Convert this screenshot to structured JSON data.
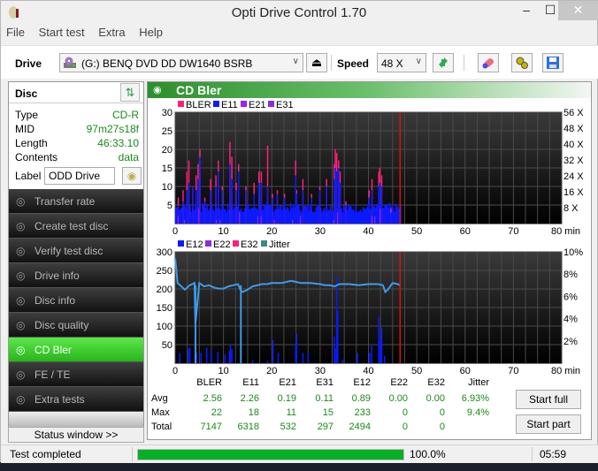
{
  "window": {
    "title": "Opti Drive Control 1.70",
    "minimize": "–",
    "maximize": "☐",
    "close": "✕"
  },
  "menu": [
    "File",
    "Start test",
    "Extra",
    "Help"
  ],
  "toolbar": {
    "drive_label": "Drive",
    "drive_value": "(G:)   BENQ DVD DD DW1640 BSRB",
    "speed_label": "Speed",
    "speed_value": "48 X",
    "icons": [
      "eject-icon",
      "refresh-icon",
      "eraser-icon",
      "settings-icon",
      "save-icon"
    ]
  },
  "disc": {
    "header": "Disc",
    "rows": [
      {
        "key": "Type",
        "value": "CD-R"
      },
      {
        "key": "MID",
        "value": "97m27s18f"
      },
      {
        "key": "Length",
        "value": "46:33.10"
      },
      {
        "key": "Contents",
        "value": "data"
      }
    ],
    "label_key": "Label",
    "label_value": "ODD Drive"
  },
  "nav": [
    {
      "label": "Transfer rate",
      "active": false
    },
    {
      "label": "Create test disc",
      "active": false
    },
    {
      "label": "Verify test disc",
      "active": false
    },
    {
      "label": "Drive info",
      "active": false
    },
    {
      "label": "Disc info",
      "active": false
    },
    {
      "label": "Disc quality",
      "active": false
    },
    {
      "label": "CD Bler",
      "active": true
    },
    {
      "label": "FE / TE",
      "active": false
    },
    {
      "label": "Extra tests",
      "active": false
    }
  ],
  "status_window_button": "Status window >>",
  "panel_title": "CD Bler",
  "colors": {
    "bler": "#ff1f7a",
    "e11": "#0b1aff",
    "e21": "#a020f0",
    "e31": "#8a2be2",
    "e12": "#0b1aff",
    "e22": "#8a2be2",
    "e32": "#ff1f7a",
    "jitter": "#3d9bea",
    "jitter_legend": "#3c8a7a",
    "marker": "#e01010",
    "accent_green": "#27b51a"
  },
  "chart_data": [
    {
      "type": "bar",
      "title": "BLER / E11 / E21 / E31",
      "legend": [
        "BLER",
        "E11",
        "E21",
        "E31"
      ],
      "legend_position": "top-left",
      "xlabel": "min",
      "x_ticks": [
        "0",
        "10",
        "20",
        "30",
        "40",
        "50",
        "60",
        "70",
        "80 min"
      ],
      "xlim": [
        0,
        80
      ],
      "ylim": [
        0,
        30
      ],
      "y_ticks": [
        "5",
        "10",
        "15",
        "20",
        "25",
        "30"
      ],
      "y2_ticks": [
        "8 X",
        "16 X",
        "24 X",
        "32 X",
        "40 X",
        "48 X",
        "56 X"
      ],
      "y2lim": [
        0,
        56
      ],
      "marker_x": 46.55,
      "grid": true,
      "series": [
        {
          "name": "BLER",
          "x": [
            0.5,
            1.5,
            2.3,
            2.7,
            3.5,
            4.2,
            4.6,
            5.0,
            6.0,
            7.2,
            8.3,
            8.8,
            9.6,
            11.2,
            11.6,
            12.5,
            13.0,
            14.5,
            16.2,
            17.2,
            17.7,
            19.0,
            20.0,
            21.0,
            22.5,
            24.8,
            25.0,
            26.3,
            28.1,
            29.8,
            31.2,
            32.8,
            33.0,
            33.3,
            33.7,
            34.0,
            35.2,
            40.0,
            40.6,
            42.0,
            42.2,
            42.6,
            43.3,
            44.5
          ],
          "values": [
            7,
            9,
            14,
            17,
            10,
            13,
            16,
            20,
            7,
            12,
            13,
            17,
            10,
            22,
            18,
            11,
            16,
            10,
            11,
            14,
            14,
            21,
            8,
            9,
            8,
            17,
            9,
            12,
            8,
            10,
            12,
            16,
            20,
            19,
            17,
            14,
            6,
            9,
            12,
            14,
            15,
            13,
            5,
            4
          ]
        },
        {
          "name": "E11",
          "x": [
            0.5,
            1.5,
            2.3,
            2.7,
            3.5,
            4.2,
            4.6,
            5.0,
            6.0,
            7.2,
            8.3,
            8.8,
            9.6,
            11.2,
            11.6,
            12.5,
            13.0,
            14.5,
            16.2,
            17.2,
            17.7,
            19.0,
            20.0,
            21.0,
            22.5,
            24.8,
            25.0,
            26.3,
            28.1,
            29.8,
            31.2,
            32.8,
            33.0,
            33.3,
            33.7,
            34.0,
            35.2,
            40.0,
            40.6,
            42.0,
            42.2,
            42.6,
            43.3,
            44.5
          ],
          "values": [
            5,
            6,
            9,
            11,
            10,
            9,
            12,
            18,
            6,
            9,
            10,
            14,
            9,
            16,
            12,
            9,
            14,
            9,
            8,
            11,
            11,
            10,
            7,
            8,
            7,
            13,
            8,
            9,
            7,
            9,
            10,
            12,
            15,
            14,
            15,
            11,
            5,
            7,
            9,
            10,
            11,
            10,
            5,
            3
          ]
        },
        {
          "name": "E21",
          "x": [
            0.5,
            4.8,
            8.4,
            13.2,
            17.7,
            20.4,
            25.8,
            33.5,
            40.6,
            42.3
          ],
          "values": [
            2,
            4,
            1,
            3,
            2,
            1,
            2,
            3,
            2,
            4
          ]
        },
        {
          "name": "E31",
          "x": [
            1.8,
            9.2,
            17.0,
            24.2,
            32.7,
            41.2
          ],
          "values": [
            1,
            1,
            2,
            1,
            1,
            2
          ]
        }
      ],
      "baseline_e11_avg": 3.5
    },
    {
      "type": "bar",
      "title": "E12 / E22 / E32 / Jitter",
      "legend": [
        "E12",
        "E22",
        "E32",
        "Jitter"
      ],
      "legend_position": "top-left",
      "xlabel": "min",
      "x_ticks": [
        "0",
        "10",
        "20",
        "30",
        "40",
        "50",
        "60",
        "70",
        "80 min"
      ],
      "xlim": [
        0,
        80
      ],
      "ylim": [
        0,
        300
      ],
      "y_ticks": [
        "50",
        "100",
        "150",
        "200",
        "250",
        "300"
      ],
      "y2_ticks": [
        "2%",
        "4%",
        "6%",
        "8%",
        "10%"
      ],
      "y2lim": [
        0,
        10
      ],
      "marker_x": 46.55,
      "grid": true,
      "series": [
        {
          "name": "E12",
          "x": [
            0.8,
            2.6,
            2.9,
            4.3,
            5.2,
            6.4,
            7.3,
            8.7,
            10.2,
            11.1,
            11.3,
            11.6,
            15.9,
            19.0,
            20.1,
            21.2,
            24.8,
            25.0,
            26.3,
            27.4,
            32.8,
            33.0,
            33.3,
            33.5,
            34.5,
            37.6,
            40.1,
            40.5,
            42.0,
            42.3,
            42.6,
            43.2
          ],
          "values": [
            28,
            38,
            43,
            28,
            28,
            42,
            35,
            30,
            24,
            33,
            48,
            38,
            8,
            7,
            62,
            28,
            50,
            80,
            28,
            28,
            72,
            40,
            233,
            140,
            10,
            28,
            28,
            48,
            125,
            65,
            95,
            20
          ]
        },
        {
          "name": "E22",
          "x": [],
          "values": []
        },
        {
          "name": "E32",
          "x": [],
          "values": []
        },
        {
          "name": "Jitter",
          "unit": "%",
          "x": [
            0,
            0.2,
            0.5,
            1,
            2,
            3,
            4,
            4.2,
            5,
            6,
            7,
            8,
            9,
            10,
            11,
            12,
            13,
            13.6,
            14,
            15,
            16,
            17,
            18,
            19,
            20,
            22,
            24,
            25,
            26,
            28,
            30,
            31,
            32,
            33,
            34,
            35,
            36,
            38,
            40,
            42,
            43,
            43.5,
            44,
            45,
            46,
            46.5
          ],
          "values": [
            9.4,
            8.6,
            7.2,
            7.0,
            6.6,
            7.0,
            7.2,
            3.5,
            7.2,
            6.9,
            7.0,
            6.8,
            6.7,
            6.7,
            6.9,
            7.0,
            7.1,
            6.5,
            6.4,
            6.6,
            6.9,
            7.0,
            7.1,
            7.1,
            7.2,
            7.2,
            7.4,
            7.3,
            7.2,
            7.2,
            7.1,
            7.0,
            7.0,
            6.9,
            7.1,
            7.1,
            7.1,
            7.0,
            7.1,
            7.1,
            7.0,
            6.4,
            6.6,
            7.2,
            7.1,
            7.0
          ]
        }
      ]
    }
  ],
  "stats": {
    "columns": [
      "BLER",
      "E11",
      "E21",
      "E31",
      "E12",
      "E22",
      "E32",
      "Jitter"
    ],
    "rows": [
      {
        "label": "Avg",
        "values": [
          "2.56",
          "2.26",
          "0.19",
          "0.11",
          "0.89",
          "0.00",
          "0.00",
          "6.93%"
        ]
      },
      {
        "label": "Max",
        "values": [
          "22",
          "18",
          "11",
          "15",
          "233",
          "0",
          "0",
          "9.4%"
        ]
      },
      {
        "label": "Total",
        "values": [
          "7147",
          "6318",
          "532",
          "297",
          "2494",
          "0",
          "0",
          ""
        ]
      }
    ]
  },
  "buttons": {
    "start_full": "Start full",
    "start_part": "Start part"
  },
  "statusbar": {
    "text": "Test completed",
    "progress": 100.0,
    "progress_text": "100.0%",
    "time": "05:59"
  }
}
